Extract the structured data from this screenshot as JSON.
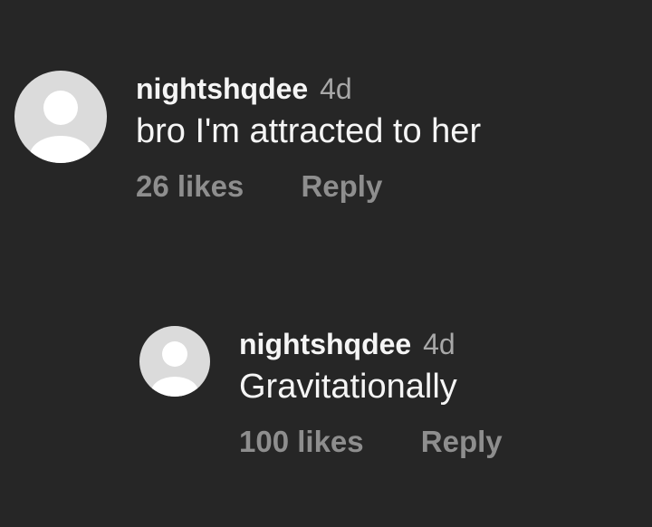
{
  "comments": [
    {
      "username": "nightshqdee",
      "time": "4d",
      "text": "bro I'm attracted to her",
      "likes": "26 likes",
      "reply_label": "Reply"
    }
  ],
  "replies": [
    {
      "username": "nightshqdee",
      "time": "4d",
      "text": "Gravitationally",
      "likes": "100 likes",
      "reply_label": "Reply"
    }
  ],
  "icons": {
    "avatar": "default-avatar-icon"
  },
  "colors": {
    "background": "#262626",
    "primary_text": "#f5f5f5",
    "secondary_text": "#a8a8a8",
    "action_text": "#8e8e8e",
    "avatar_bg": "#dbdbdb"
  }
}
